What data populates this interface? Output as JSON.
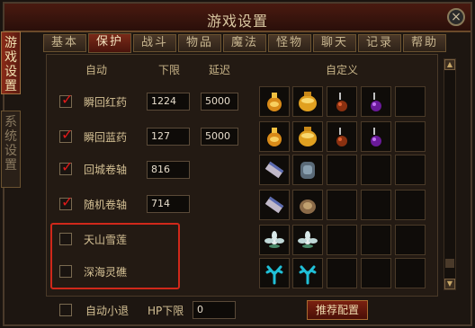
{
  "window": {
    "title": "游戏设置",
    "close_symbol": "×"
  },
  "side_tabs": [
    {
      "label": "游戏设置"
    },
    {
      "label": "系统设置"
    }
  ],
  "tabs": [
    {
      "label": "基本"
    },
    {
      "label": "保护"
    },
    {
      "label": "战斗"
    },
    {
      "label": "物品"
    },
    {
      "label": "魔法"
    },
    {
      "label": "怪物"
    },
    {
      "label": "聊天"
    },
    {
      "label": "记录"
    },
    {
      "label": "帮助"
    }
  ],
  "columns": {
    "auto": "自动",
    "lower": "下限",
    "delay": "延迟",
    "custom": "自定义"
  },
  "rows": [
    {
      "checked": true,
      "label": "瞬回红药",
      "lower": "1224",
      "delay": "5000",
      "items": [
        "gold-potion",
        "gold-potion-large",
        "red-flask",
        "purple-flask",
        "empty"
      ]
    },
    {
      "checked": true,
      "label": "瞬回蓝药",
      "lower": "127",
      "delay": "5000",
      "items": [
        "gold-potion",
        "gold-potion-large",
        "red-flask",
        "purple-flask",
        "empty"
      ]
    },
    {
      "checked": true,
      "label": "回城卷轴",
      "lower": "816",
      "delay": "",
      "items": [
        "scroll",
        "stone",
        "empty",
        "empty",
        "empty"
      ]
    },
    {
      "checked": true,
      "label": "随机卷轴",
      "lower": "714",
      "delay": "",
      "items": [
        "scroll",
        "bag",
        "empty",
        "empty",
        "empty"
      ]
    },
    {
      "checked": false,
      "label": "天山雪莲",
      "lower": "",
      "delay": "",
      "items": [
        "lotus",
        "lotus",
        "empty",
        "empty",
        "empty"
      ]
    },
    {
      "checked": false,
      "label": "深海灵礁",
      "lower": "",
      "delay": "",
      "items": [
        "coral",
        "coral",
        "empty",
        "empty",
        "empty"
      ]
    }
  ],
  "footer": {
    "auto_quit_label": "自动小退",
    "hp_label": "HP下限",
    "hp_value": "0",
    "recommend_button": "推荐配置"
  },
  "colors": {
    "accent_red": "#d0281a",
    "check_red": "#e01a1a",
    "text_gold": "#d4c094"
  }
}
